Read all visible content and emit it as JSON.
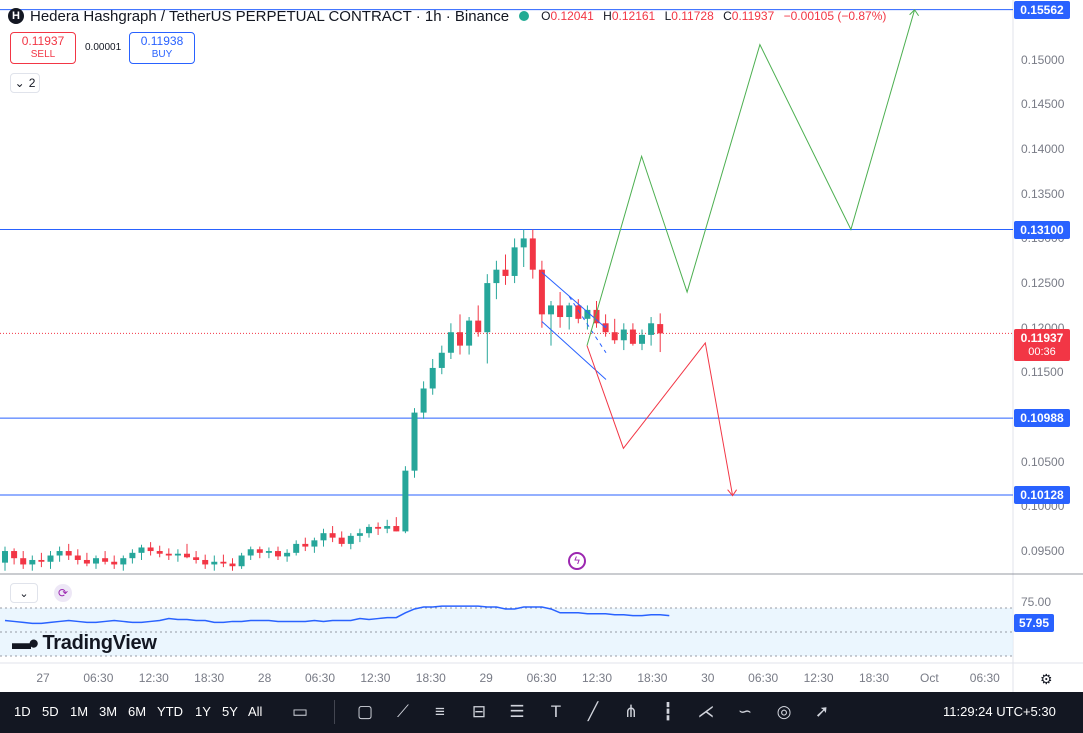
{
  "header": {
    "symbol_logo": "H",
    "title": "Hedera Hashgraph / TetherUS PERPETUAL CONTRACT · 1h · Binance",
    "market_status_color": "#22ab94",
    "ohlc": {
      "o_label": "O",
      "o": "0.12041",
      "h_label": "H",
      "h": "0.12161",
      "l_label": "L",
      "l": "0.11728",
      "c_label": "C",
      "c": "0.11937",
      "change": "−0.00105 (−0.87%)"
    }
  },
  "trade": {
    "sell_price": "0.11937",
    "sell_label": "SELL",
    "spread": "0.00001",
    "buy_price": "0.11938",
    "buy_label": "BUY"
  },
  "indicators_collapse": {
    "count": "2"
  },
  "price_axis": {
    "labels": [
      "0.15000",
      "0.14500",
      "0.14000",
      "0.13500",
      "0.13000",
      "0.12500",
      "0.12000",
      "0.11500",
      "0.10500",
      "0.10000",
      "0.09500"
    ],
    "levels": [
      "0.15562",
      "0.13100",
      "0.10988",
      "0.10128"
    ],
    "current_price": "0.11937",
    "countdown": "00:36"
  },
  "rsi": {
    "axis_label": "75.00",
    "value": "57.95",
    "color": "#2962ff"
  },
  "logo": {
    "text": "TradingView"
  },
  "time_axis": [
    "27",
    "06:30",
    "12:30",
    "18:30",
    "28",
    "06:30",
    "12:30",
    "18:30",
    "29",
    "06:30",
    "12:30",
    "18:30",
    "30",
    "06:30",
    "12:30",
    "18:30",
    "Oct",
    "06:30"
  ],
  "bottom_toolbar": {
    "ranges": [
      "1D",
      "5D",
      "1M",
      "3M",
      "6M",
      "YTD",
      "1Y",
      "5Y",
      "All"
    ],
    "tools": [
      "calendar-range-icon",
      "rectangle-icon",
      "path-icon",
      "fib-icon",
      "long-short-icon",
      "lines-icon",
      "text-icon",
      "trendline-icon",
      "pitchfork-icon",
      "bars-pattern-icon",
      "xabcd-icon",
      "curve-icon",
      "circle-icon",
      "arrow-icon"
    ],
    "clock": "11:29:24 UTC+5:30"
  },
  "colors": {
    "bull": "#26a69a",
    "bear": "#f23645",
    "level_line": "#2962ff",
    "projection_up": "#4caf50",
    "projection_down": "#f23645"
  },
  "chart_data": {
    "type": "candlestick",
    "symbol": "HBARUSDT.P",
    "interval": "1h",
    "ylim": [
      0.093,
      0.157
    ],
    "horizontal_levels": [
      0.15562,
      0.131,
      0.10988,
      0.10128
    ],
    "current_price": 0.11937,
    "candles": [
      {
        "o": 0.0937,
        "h": 0.0955,
        "l": 0.0928,
        "c": 0.095
      },
      {
        "o": 0.095,
        "h": 0.0953,
        "l": 0.0935,
        "c": 0.0942
      },
      {
        "o": 0.0942,
        "h": 0.095,
        "l": 0.093,
        "c": 0.0935
      },
      {
        "o": 0.0935,
        "h": 0.0945,
        "l": 0.0928,
        "c": 0.094
      },
      {
        "o": 0.094,
        "h": 0.0948,
        "l": 0.0932,
        "c": 0.0938
      },
      {
        "o": 0.0938,
        "h": 0.095,
        "l": 0.093,
        "c": 0.0945
      },
      {
        "o": 0.0945,
        "h": 0.0955,
        "l": 0.0938,
        "c": 0.095
      },
      {
        "o": 0.095,
        "h": 0.0958,
        "l": 0.094,
        "c": 0.0945
      },
      {
        "o": 0.0945,
        "h": 0.0952,
        "l": 0.0935,
        "c": 0.094
      },
      {
        "o": 0.094,
        "h": 0.0948,
        "l": 0.0933,
        "c": 0.0936
      },
      {
        "o": 0.0936,
        "h": 0.0945,
        "l": 0.093,
        "c": 0.0942
      },
      {
        "o": 0.0942,
        "h": 0.095,
        "l": 0.0935,
        "c": 0.0938
      },
      {
        "o": 0.0938,
        "h": 0.0945,
        "l": 0.093,
        "c": 0.0935
      },
      {
        "o": 0.0935,
        "h": 0.0945,
        "l": 0.0928,
        "c": 0.0942
      },
      {
        "o": 0.0942,
        "h": 0.0952,
        "l": 0.0936,
        "c": 0.0948
      },
      {
        "o": 0.0948,
        "h": 0.0957,
        "l": 0.094,
        "c": 0.0954
      },
      {
        "o": 0.0954,
        "h": 0.096,
        "l": 0.0945,
        "c": 0.095
      },
      {
        "o": 0.095,
        "h": 0.0956,
        "l": 0.0943,
        "c": 0.0947
      },
      {
        "o": 0.0947,
        "h": 0.0953,
        "l": 0.094,
        "c": 0.0945
      },
      {
        "o": 0.0945,
        "h": 0.0952,
        "l": 0.0938,
        "c": 0.0947
      },
      {
        "o": 0.0947,
        "h": 0.0958,
        "l": 0.0942,
        "c": 0.0943
      },
      {
        "o": 0.0943,
        "h": 0.095,
        "l": 0.0936,
        "c": 0.094
      },
      {
        "o": 0.094,
        "h": 0.0946,
        "l": 0.093,
        "c": 0.0935
      },
      {
        "o": 0.0935,
        "h": 0.0945,
        "l": 0.0928,
        "c": 0.0938
      },
      {
        "o": 0.0938,
        "h": 0.0946,
        "l": 0.0932,
        "c": 0.0936
      },
      {
        "o": 0.0936,
        "h": 0.0942,
        "l": 0.0928,
        "c": 0.0933
      },
      {
        "o": 0.0933,
        "h": 0.0948,
        "l": 0.093,
        "c": 0.0945
      },
      {
        "o": 0.0945,
        "h": 0.0955,
        "l": 0.094,
        "c": 0.0952
      },
      {
        "o": 0.0952,
        "h": 0.0955,
        "l": 0.0942,
        "c": 0.0948
      },
      {
        "o": 0.0948,
        "h": 0.0954,
        "l": 0.0942,
        "c": 0.095
      },
      {
        "o": 0.095,
        "h": 0.0955,
        "l": 0.094,
        "c": 0.0944
      },
      {
        "o": 0.0944,
        "h": 0.0952,
        "l": 0.0938,
        "c": 0.0948
      },
      {
        "o": 0.0948,
        "h": 0.0962,
        "l": 0.0945,
        "c": 0.0958
      },
      {
        "o": 0.0958,
        "h": 0.0965,
        "l": 0.095,
        "c": 0.0955
      },
      {
        "o": 0.0955,
        "h": 0.0965,
        "l": 0.0948,
        "c": 0.0962
      },
      {
        "o": 0.0962,
        "h": 0.0975,
        "l": 0.0955,
        "c": 0.097
      },
      {
        "o": 0.097,
        "h": 0.0978,
        "l": 0.096,
        "c": 0.0965
      },
      {
        "o": 0.0965,
        "h": 0.0972,
        "l": 0.0955,
        "c": 0.0958
      },
      {
        "o": 0.0958,
        "h": 0.097,
        "l": 0.0952,
        "c": 0.0967
      },
      {
        "o": 0.0967,
        "h": 0.0975,
        "l": 0.096,
        "c": 0.097
      },
      {
        "o": 0.097,
        "h": 0.098,
        "l": 0.0965,
        "c": 0.0977
      },
      {
        "o": 0.0977,
        "h": 0.0982,
        "l": 0.0968,
        "c": 0.0975
      },
      {
        "o": 0.0975,
        "h": 0.0985,
        "l": 0.097,
        "c": 0.0978
      },
      {
        "o": 0.0978,
        "h": 0.0988,
        "l": 0.0972,
        "c": 0.0972
      },
      {
        "o": 0.0972,
        "h": 0.1045,
        "l": 0.097,
        "c": 0.104
      },
      {
        "o": 0.104,
        "h": 0.111,
        "l": 0.1032,
        "c": 0.1105
      },
      {
        "o": 0.1105,
        "h": 0.114,
        "l": 0.1098,
        "c": 0.1132
      },
      {
        "o": 0.1132,
        "h": 0.1165,
        "l": 0.1125,
        "c": 0.1155
      },
      {
        "o": 0.1155,
        "h": 0.118,
        "l": 0.1148,
        "c": 0.1172
      },
      {
        "o": 0.1172,
        "h": 0.1205,
        "l": 0.1165,
        "c": 0.1195
      },
      {
        "o": 0.1195,
        "h": 0.1215,
        "l": 0.117,
        "c": 0.118
      },
      {
        "o": 0.118,
        "h": 0.1212,
        "l": 0.117,
        "c": 0.1208
      },
      {
        "o": 0.1208,
        "h": 0.1225,
        "l": 0.119,
        "c": 0.1195
      },
      {
        "o": 0.1195,
        "h": 0.126,
        "l": 0.116,
        "c": 0.125
      },
      {
        "o": 0.125,
        "h": 0.1275,
        "l": 0.1232,
        "c": 0.1265
      },
      {
        "o": 0.1265,
        "h": 0.1282,
        "l": 0.1248,
        "c": 0.1258
      },
      {
        "o": 0.1258,
        "h": 0.13,
        "l": 0.125,
        "c": 0.129
      },
      {
        "o": 0.129,
        "h": 0.131,
        "l": 0.1268,
        "c": 0.13
      },
      {
        "o": 0.13,
        "h": 0.131,
        "l": 0.1255,
        "c": 0.1265
      },
      {
        "o": 0.1265,
        "h": 0.1275,
        "l": 0.12,
        "c": 0.1215
      },
      {
        "o": 0.1215,
        "h": 0.123,
        "l": 0.118,
        "c": 0.1225
      },
      {
        "o": 0.1225,
        "h": 0.124,
        "l": 0.12,
        "c": 0.1212
      },
      {
        "o": 0.1212,
        "h": 0.1228,
        "l": 0.1198,
        "c": 0.1225
      },
      {
        "o": 0.1225,
        "h": 0.1232,
        "l": 0.1205,
        "c": 0.121
      },
      {
        "o": 0.121,
        "h": 0.1225,
        "l": 0.1198,
        "c": 0.122
      },
      {
        "o": 0.122,
        "h": 0.123,
        "l": 0.12,
        "c": 0.1205
      },
      {
        "o": 0.1205,
        "h": 0.1215,
        "l": 0.119,
        "c": 0.1195
      },
      {
        "o": 0.1195,
        "h": 0.121,
        "l": 0.1182,
        "c": 0.1186
      },
      {
        "o": 0.1186,
        "h": 0.1205,
        "l": 0.1175,
        "c": 0.1198
      },
      {
        "o": 0.1198,
        "h": 0.1205,
        "l": 0.118,
        "c": 0.1182
      },
      {
        "o": 0.1182,
        "h": 0.1198,
        "l": 0.1175,
        "c": 0.1192
      },
      {
        "o": 0.1192,
        "h": 0.1212,
        "l": 0.118,
        "c": 0.1205
      },
      {
        "o": 0.12041,
        "h": 0.12161,
        "l": 0.11728,
        "c": 0.11937
      }
    ],
    "projection_up": [
      [
        0,
        0.118
      ],
      [
        6,
        0.1392
      ],
      [
        11,
        0.124
      ],
      [
        19,
        0.1517
      ],
      [
        29,
        0.131
      ],
      [
        36,
        0.1556
      ]
    ],
    "projection_down": [
      [
        0,
        0.118
      ],
      [
        4,
        0.1065
      ],
      [
        13,
        0.1183
      ],
      [
        16,
        0.1012
      ]
    ],
    "rsi": [
      62,
      61,
      60,
      59,
      59,
      60,
      61,
      62,
      61,
      60,
      60,
      61,
      62,
      61,
      60,
      60,
      61,
      62,
      64,
      63,
      63,
      62,
      62,
      60,
      60,
      61,
      61,
      62,
      62,
      62,
      61,
      61,
      61,
      61,
      62,
      61,
      62,
      62,
      62,
      64,
      63,
      64,
      65,
      65,
      70,
      74,
      76,
      76,
      77,
      77,
      77,
      77,
      77,
      76,
      76,
      74,
      74,
      76,
      76,
      76,
      74,
      70,
      70,
      70,
      69,
      69,
      69,
      68,
      68,
      67,
      67,
      68,
      68,
      67
    ]
  }
}
